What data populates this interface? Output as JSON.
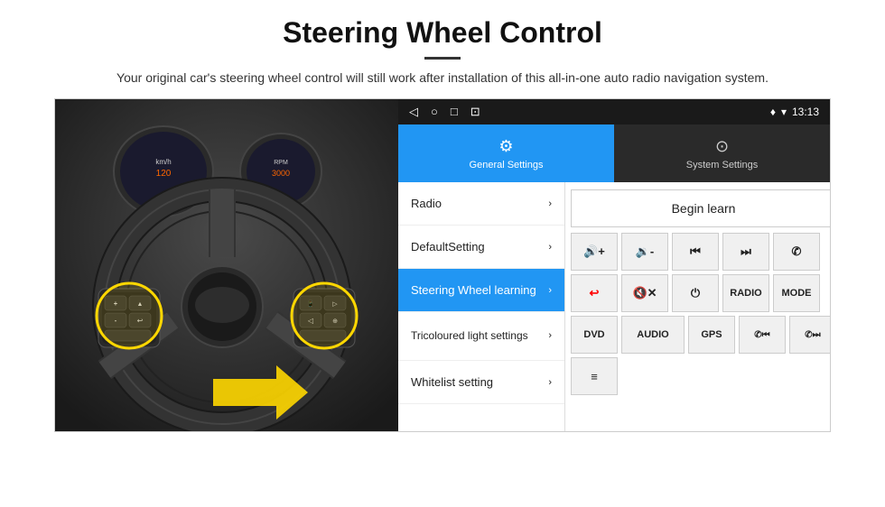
{
  "header": {
    "title": "Steering Wheel Control",
    "divider": true,
    "subtitle": "Your original car's steering wheel control will still work after installation of this all-in-one auto radio navigation system."
  },
  "statusBar": {
    "icons": [
      "◁",
      "○",
      "□",
      "⊡"
    ],
    "rightIcons": "♦ ▾",
    "time": "13:13"
  },
  "tabs": [
    {
      "id": "general",
      "label": "General Settings",
      "icon": "⚙",
      "active": true
    },
    {
      "id": "system",
      "label": "System Settings",
      "icon": "⊙",
      "active": false
    }
  ],
  "menuItems": [
    {
      "id": "radio",
      "label": "Radio",
      "active": false
    },
    {
      "id": "default",
      "label": "DefaultSetting",
      "active": false
    },
    {
      "id": "steering",
      "label": "Steering Wheel learning",
      "active": true
    },
    {
      "id": "tricoloured",
      "label": "Tricoloured light settings",
      "active": false
    },
    {
      "id": "whitelist",
      "label": "Whitelist setting",
      "active": false
    }
  ],
  "beginLearnBtn": "Begin learn",
  "controlButtons": {
    "row1": [
      {
        "id": "vol-up",
        "label": "🔊+",
        "unicode": "▲+"
      },
      {
        "id": "vol-down",
        "label": "🔉-",
        "unicode": "▼-"
      },
      {
        "id": "prev-track",
        "label": "⏮",
        "unicode": "⏮"
      },
      {
        "id": "next-track",
        "label": "⏭",
        "unicode": "⏭"
      },
      {
        "id": "phone",
        "label": "📞",
        "unicode": "✆"
      }
    ],
    "row2": [
      {
        "id": "end-call",
        "label": "↩",
        "unicode": "↩"
      },
      {
        "id": "mute",
        "label": "🔇x",
        "unicode": "🔇"
      },
      {
        "id": "power",
        "label": "⏻",
        "unicode": "⏻"
      },
      {
        "id": "radio-btn",
        "label": "RADIO",
        "unicode": "RADIO"
      },
      {
        "id": "mode",
        "label": "MODE",
        "unicode": "MODE"
      }
    ],
    "row3": [
      {
        "id": "dvd",
        "label": "DVD",
        "unicode": "DVD"
      },
      {
        "id": "audio",
        "label": "AUDIO",
        "unicode": "AUDIO"
      },
      {
        "id": "gps",
        "label": "GPS",
        "unicode": "GPS"
      },
      {
        "id": "tel-prev",
        "label": "📞⏮",
        "unicode": "✆⏮"
      },
      {
        "id": "tel-next",
        "label": "📞⏭",
        "unicode": "✆⏭"
      }
    ],
    "row4": [
      {
        "id": "list",
        "label": "≡",
        "unicode": "≡"
      }
    ]
  }
}
